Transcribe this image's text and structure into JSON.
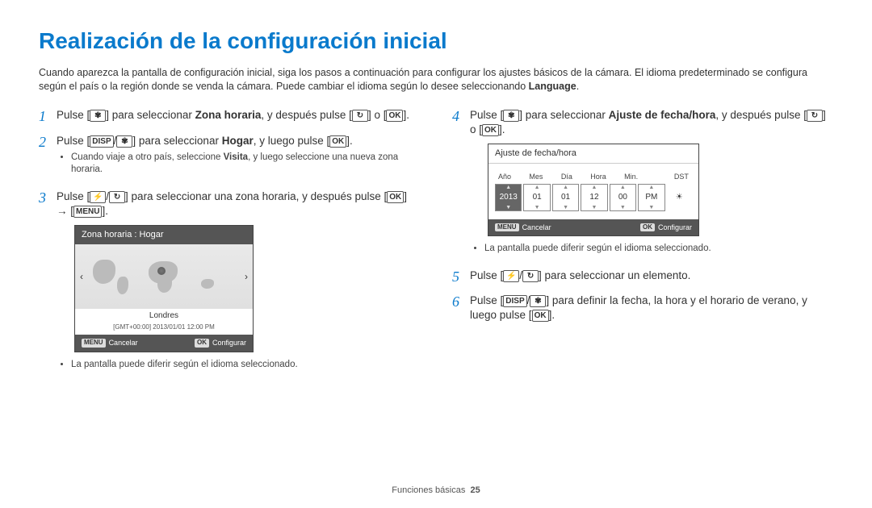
{
  "title": "Realización de la configuración inicial",
  "intro_a": "Cuando aparezca la pantalla de configuración inicial, siga los pasos a continuación para configurar los ajustes básicos de la cámara. El idioma predeterminado se configura según el país o la región donde se venda la cámara. Puede cambiar el idioma según lo desee seleccionando ",
  "intro_lang": "Language",
  "intro_b": ".",
  "steps": {
    "s1a": "Pulse [",
    "s1b": "] para seleccionar ",
    "s1c": "Zona horaria",
    "s1d": ", y después pulse [",
    "s1e": "] o [",
    "s1f": "].",
    "s2a": "Pulse [",
    "s2b": "] para seleccionar ",
    "s2c": "Hogar",
    "s2d": ", y luego pulse [",
    "s2e": "].",
    "s2note_a": "Cuando viaje a otro país, seleccione ",
    "s2note_b": "Visita",
    "s2note_c": ", y luego seleccione una nueva zona horaria.",
    "s3a": "Pulse [",
    "s3b": "] para seleccionar una zona horaria, y después pulse [",
    "s3c": "] → [",
    "s3d": "].",
    "s3note": "La pantalla puede diferir según el idioma seleccionado.",
    "s4a": "Pulse [",
    "s4b": "] para seleccionar ",
    "s4c": "Ajuste de fecha/hora",
    "s4d": ", y después pulse [",
    "s4e": "] o [",
    "s4f": "].",
    "s4note": "La pantalla puede diferir según el idioma seleccionado.",
    "s5a": "Pulse [",
    "s5b": "] para seleccionar un elemento.",
    "s6a": "Pulse [",
    "s6b": "] para definir la fecha, la hora y el horario de verano, y luego pulse [",
    "s6c": "]."
  },
  "keys": {
    "macro": "✾",
    "timer": "↻",
    "ok": "OK",
    "disp": "DISP",
    "flash": "⚡",
    "menu": "MENU"
  },
  "lcd_tz": {
    "title": "Zona horaria : Hogar",
    "city": "Londres",
    "timestamp": "[GMT+00:00] 2013/01/01 12:00 PM",
    "cancel_key": "MENU",
    "cancel": "Cancelar",
    "set_key": "OK",
    "set": "Configurar"
  },
  "lcd_dt": {
    "title": "Ajuste de fecha/hora",
    "headers": [
      "Año",
      "Mes",
      "Día",
      "Hora",
      "Min.",
      "",
      "DST"
    ],
    "values": [
      "2013",
      "01",
      "01",
      "12",
      "00",
      "PM",
      "☀"
    ],
    "cancel_key": "MENU",
    "cancel": "Cancelar",
    "set_key": "OK",
    "set": "Configurar"
  },
  "footer": {
    "section": "Funciones básicas",
    "page": "25"
  }
}
